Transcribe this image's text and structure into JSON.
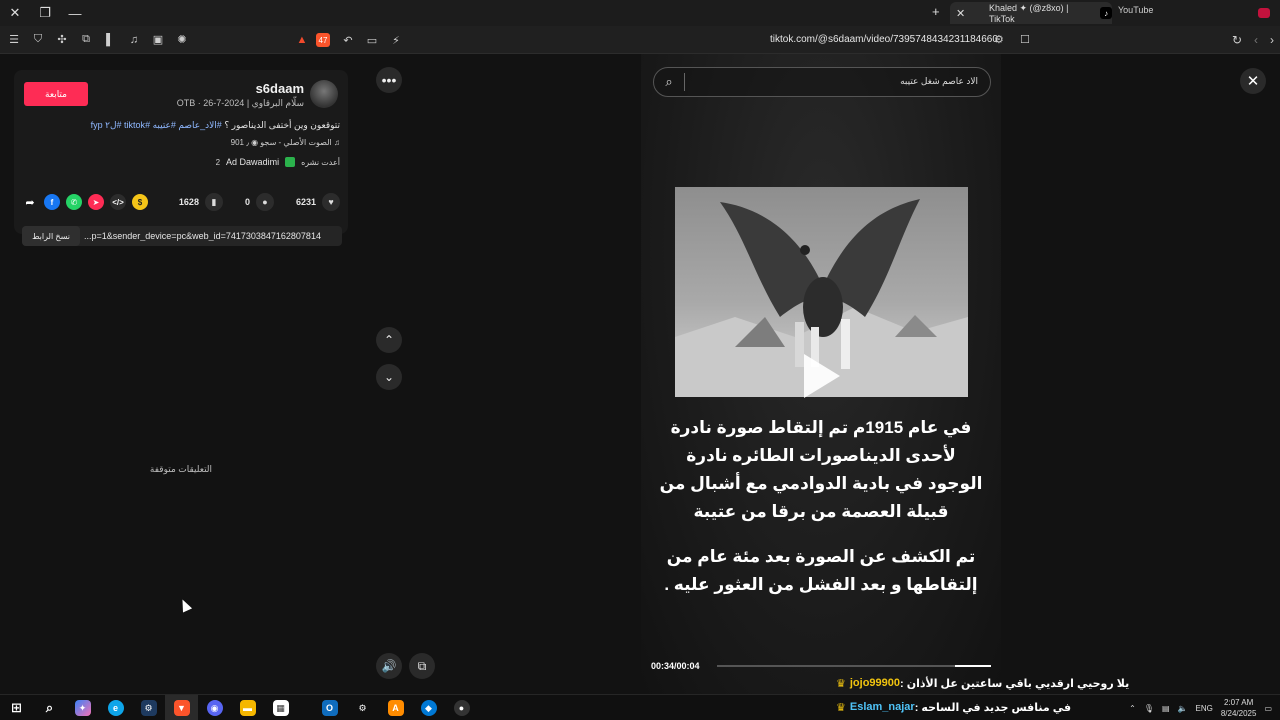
{
  "browser": {
    "active_tab_title": "Khaled ✦ (@z8xo) | TikTok",
    "youtube_tab": "YouTube",
    "url": "tiktok.com/@s6daam/video/7395748434231184660",
    "shield_badge": "47"
  },
  "post": {
    "follow_label": "متابعة",
    "username": "s6daam",
    "meta": "سلّام البرقاوي | OTB · 26-7-2024",
    "caption_text": "تتوقعون وين أختفى الديناصور ؟",
    "caption_hashtags": "#الاد_عاصم #عتيبه #tiktok #ل٢ fyp",
    "sound": "الصوت الأصلي - سجو ◉ ٫ 901",
    "repost_label": "أعدت نشره",
    "repost_user": "Ad Dawadimi",
    "repost_count": "2"
  },
  "stats": {
    "likes": "6231",
    "comments": "0",
    "saves": "1628"
  },
  "share": {
    "copy_label": "نسخ الرابط",
    "link": "...p=1&sender_device=pc&web_id=7417303847162807814"
  },
  "comments_disabled": "التعليقات متوقفة",
  "video": {
    "search_text": "الاد عاصم شغل عتيبه",
    "text_para1": [
      "في عام 1915م تم إلتقاط صورة نادرة",
      "لأحدى الديناصورات الطائره نادرة",
      "الوجود في بادية الدوادمي مع أشبال من",
      "قبيلة العصمة من برقا من عتيبة"
    ],
    "text_para2": [
      "تم الكشف عن الصورة بعد مئة عام من",
      "إلتقاطها و بعد الفشل من العثور عليه ."
    ],
    "time": "00:34/00:04",
    "progress": 0.13
  },
  "overlay": {
    "line1_user": "jojo99900",
    "line1_msg": "يلا روحيي ارقديي باقي ساعتين عل الأذان :",
    "line2_user": "Eslam_najar",
    "line2_msg": "في منافس جديد في الساحه :"
  },
  "taskbar": {
    "lang": "ENG",
    "time": "2:07 AM",
    "date": "8/24/2025"
  }
}
